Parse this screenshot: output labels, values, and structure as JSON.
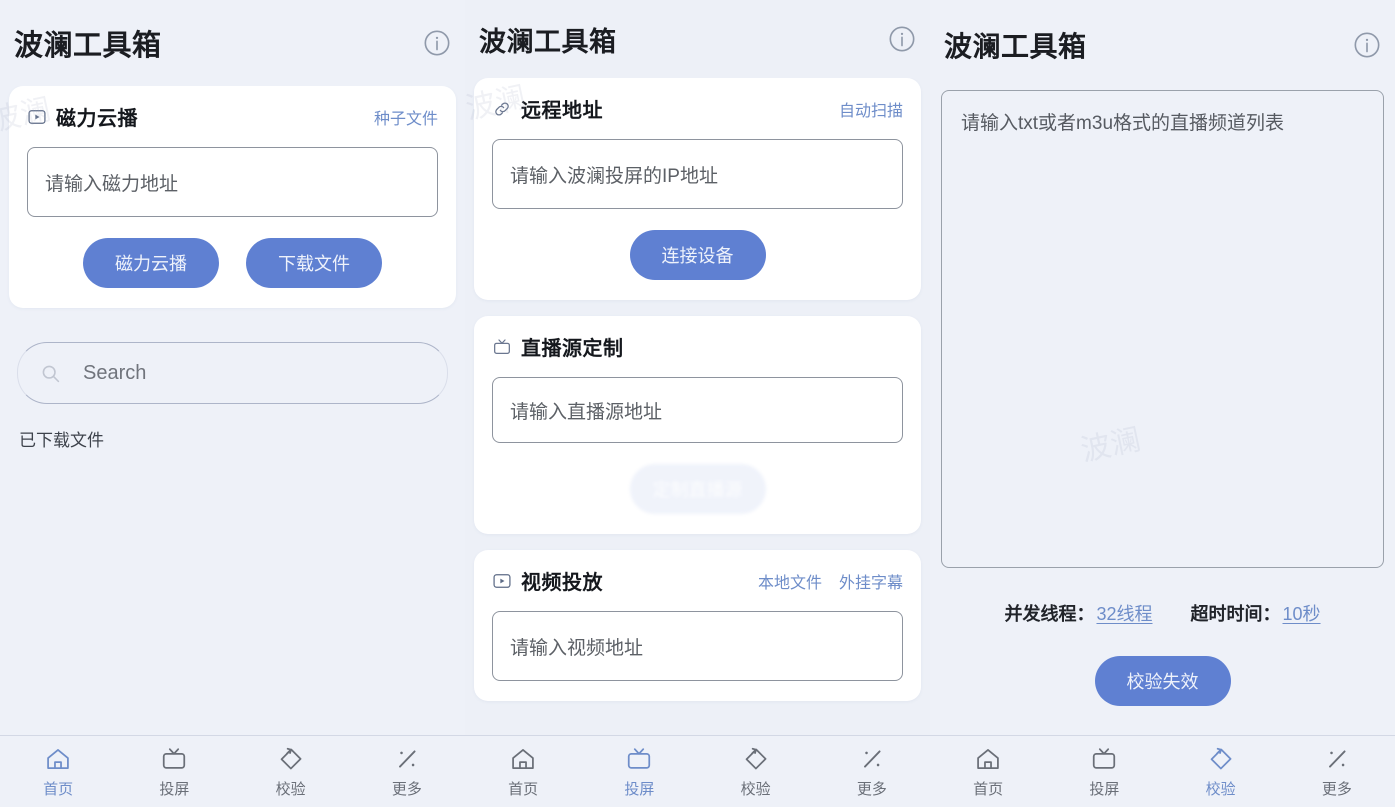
{
  "app": {
    "title": "波澜工具箱",
    "info_icon": "info-circle-icon",
    "accent_color": "#6e8dc9",
    "button_color": "#5f80d2",
    "background_color": "#eef1f8",
    "card_color": "#ffffff"
  },
  "screens": [
    {
      "id": "home",
      "title": "波澜工具箱",
      "cards": [
        {
          "id": "magnet-cloud-play",
          "icon": "play-box-icon",
          "title": "磁力云播",
          "actions": [
            "种子文件"
          ],
          "input_placeholder": "请输入磁力地址",
          "buttons": [
            "磁力云播",
            "下载文件"
          ]
        }
      ],
      "search": {
        "icon": "search-icon",
        "placeholder": "Search"
      },
      "section_label": "已下载文件",
      "tabbar": {
        "active": "首页",
        "items": [
          {
            "label": "首页",
            "icon": "home-icon"
          },
          {
            "label": "投屏",
            "icon": "tv-icon"
          },
          {
            "label": "校验",
            "icon": "refresh-tag-icon"
          },
          {
            "label": "更多",
            "icon": "more-percent-icon"
          }
        ]
      }
    },
    {
      "id": "cast",
      "title": "波澜工具箱",
      "cards": [
        {
          "id": "remote-address",
          "icon": "link-icon",
          "title": "远程地址",
          "actions": [
            "自动扫描"
          ],
          "input_placeholder": "请输入波澜投屏的IP地址",
          "buttons": [
            "连接设备"
          ]
        },
        {
          "id": "live-source-custom",
          "icon": "tv-icon",
          "title": "直播源定制",
          "actions": [],
          "input_placeholder": "请输入直播源地址",
          "buttons": [
            "定制直播源"
          ]
        },
        {
          "id": "video-cast",
          "icon": "play-box-icon",
          "title": "视频投放",
          "actions": [
            "本地文件",
            "外挂字幕"
          ],
          "input_placeholder": "请输入视频地址",
          "buttons": []
        }
      ],
      "tabbar": {
        "active": "投屏",
        "items": [
          {
            "label": "首页",
            "icon": "home-icon"
          },
          {
            "label": "投屏",
            "icon": "tv-icon"
          },
          {
            "label": "校验",
            "icon": "refresh-tag-icon"
          },
          {
            "label": "更多",
            "icon": "more-percent-icon"
          }
        ]
      }
    },
    {
      "id": "verify",
      "title": "波澜工具箱",
      "textarea_placeholder": "请输入txt或者m3u格式的直播频道列表",
      "settings": [
        {
          "label": "并发线程：",
          "value": "32线程"
        },
        {
          "label": "超时时间：",
          "value": "10秒"
        }
      ],
      "primary_button": "校验失效",
      "tabbar": {
        "active": "校验",
        "items": [
          {
            "label": "首页",
            "icon": "home-icon"
          },
          {
            "label": "投屏",
            "icon": "tv-icon"
          },
          {
            "label": "校验",
            "icon": "refresh-tag-icon"
          },
          {
            "label": "更多",
            "icon": "more-percent-icon"
          }
        ]
      }
    }
  ]
}
